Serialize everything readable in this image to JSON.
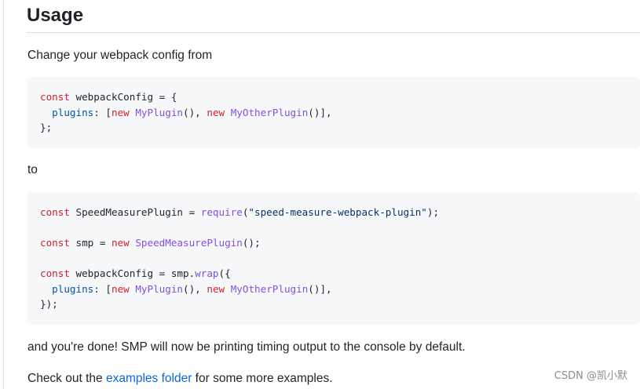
{
  "heading": "Usage",
  "intro": "Change your webpack config from",
  "code_before": {
    "line1": {
      "kw": "const",
      "rest": " webpackConfig = {"
    },
    "line2": {
      "indent": "  ",
      "prop": "plugins",
      "colon": ": [",
      "new1": "new",
      "cls1": "MyPlugin",
      "mid": "(), ",
      "new2": "new",
      "cls2": "MyOtherPlugin",
      "end": "()],"
    },
    "line3": "};"
  },
  "to_text": "to",
  "code_after": {
    "line1": {
      "kw": "const",
      "rest": " SpeedMeasurePlugin = ",
      "fn": "require",
      "open": "(",
      "str": "\"speed-measure-webpack-plugin\"",
      "close": ");"
    },
    "line2": {
      "kw": "const",
      "rest": " smp = ",
      "new": "new",
      "cls": "SpeedMeasurePlugin",
      "end": "();"
    },
    "line3": {
      "kw": "const",
      "rest": " webpackConfig = smp.",
      "fn": "wrap",
      "end": "({"
    },
    "line4": {
      "indent": "  ",
      "prop": "plugins",
      "colon": ": [",
      "new1": "new",
      "cls1": "MyPlugin",
      "mid": "(), ",
      "new2": "new",
      "cls2": "MyOtherPlugin",
      "end": "()],"
    },
    "line5": "});"
  },
  "done_text": "and you're done! SMP will now be printing timing output to the console by default.",
  "checkout": {
    "before": "Check out the ",
    "link": "examples folder",
    "after": " for some more examples."
  },
  "watermark": "CSDN @凯小默",
  "colors": {
    "keyword": "#cf222e",
    "entity": "#8250df",
    "property": "#0550ae",
    "string": "#0a3069",
    "link": "#0969da",
    "code_bg": "#f6f8fa"
  }
}
